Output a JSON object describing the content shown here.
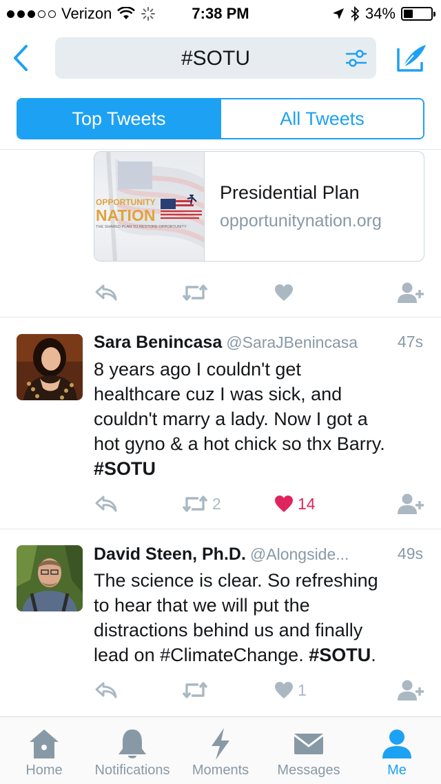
{
  "status_bar": {
    "carrier": "Verizon",
    "time": "7:38 PM",
    "battery": "34%",
    "battery_level": 0.34,
    "signal_bars_filled": 3,
    "signal_bars_total": 5,
    "icons": [
      "wifi-icon",
      "activity-spinner-icon",
      "location-arrow-icon",
      "bluetooth-icon",
      "battery-icon"
    ]
  },
  "header": {
    "search_query": "#SOTU",
    "icons": [
      "back-chevron-icon",
      "filter-sliders-icon",
      "compose-tweet-icon"
    ]
  },
  "tabs": [
    {
      "label": "Top Tweets",
      "active": true
    },
    {
      "label": "All Tweets",
      "active": false
    }
  ],
  "card": {
    "title": "Presidential Plan",
    "domain": "opportunitynation.org",
    "logo": {
      "line1": "OPPORTUNITY",
      "line2": "NATION",
      "tagline": "THE SHARED PLAN TO RESTORE OPPORTUNITY"
    }
  },
  "tweets": [
    {
      "name": "Sara Benincasa",
      "handle": "@SaraJBenincasa",
      "time": "47s",
      "lines": [
        "8 years ago I couldn't get",
        "healthcare cuz I was sick, and",
        "couldn't marry a lady. Now I got a",
        "hot gyno & a hot chick so thx Barry."
      ],
      "hashtag": "#SOTU",
      "retweets": "2",
      "likes": "14",
      "liked": true
    },
    {
      "name": "David Steen, Ph.D.",
      "handle": "@Alongside...",
      "time": "49s",
      "lines": [
        "The science is clear. So refreshing",
        "to hear that we will put the",
        "distractions behind us and finally"
      ],
      "last_line_text": "lead on #ClimateChange. ",
      "hashtag": "#SOTU",
      "trailing": ".",
      "retweets": "",
      "likes": "1",
      "liked": false
    }
  ],
  "colors": {
    "accent": "#1da1f2",
    "like": "#e0245e",
    "muted": "#aab8c2",
    "handle": "#8899a6"
  },
  "tab_bar": [
    {
      "label": "Home",
      "icon": "home-icon",
      "active": false
    },
    {
      "label": "Notifications",
      "icon": "bell-icon",
      "active": false
    },
    {
      "label": "Moments",
      "icon": "lightning-icon",
      "active": false
    },
    {
      "label": "Messages",
      "icon": "envelope-icon",
      "active": false
    },
    {
      "label": "Me",
      "icon": "person-icon",
      "active": true
    }
  ]
}
